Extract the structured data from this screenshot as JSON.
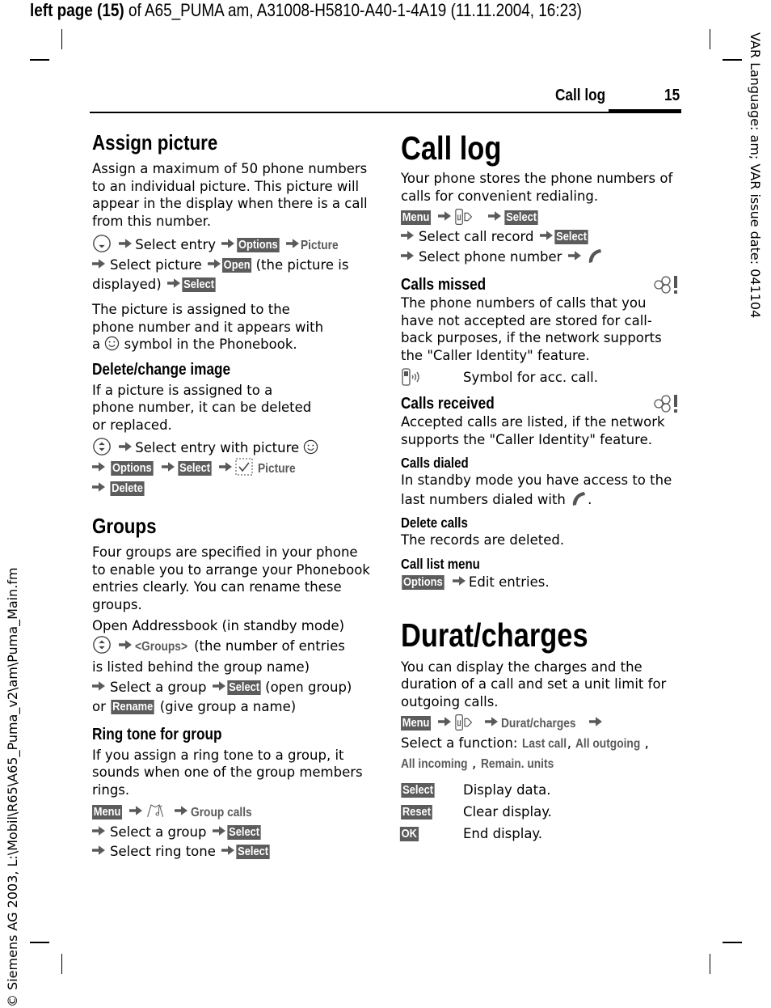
{
  "print_header": {
    "bold_part": "left page (15)",
    "rest": " of A65_PUMA am, A31008-H5810-A40-1-4A19 (11.11.2004, 16:23)"
  },
  "side_right_text": "VAR Language: am; VAR issue date: 041104",
  "side_left_text": "© Siemens AG 2003, L:\\Mobil\\R65\\A65_Puma_v2\\am\\Puma_Main.fm",
  "running_header": {
    "title": "Call log",
    "page_number": "15"
  },
  "left_column": {
    "assign_picture": {
      "heading": "Assign picture",
      "body": "Assign a maximum of 50 phone numbers to an individual picture. This picture will appear in the display when there is a call from this number.",
      "steps": {
        "s1_text": "Select entry",
        "s1_key": "Options",
        "s1_menu": "Picture",
        "s2_text": "Select picture",
        "s2_key": "Open",
        "s2_after": "(the picture is",
        "s3_text": "displayed)",
        "s3_key": "Select"
      },
      "note_line1": "The picture is assigned to the",
      "note_line2": "phone number and it appears with",
      "note_line3_a": "a",
      "note_line3_b": "symbol in the Phonebook."
    },
    "delete_change": {
      "heading": "Delete/change image",
      "body_line1": "If a picture is assigned to a",
      "body_line2": "phone number, it can be deleted",
      "body_line3": "or replaced.",
      "step1_text": "Select entry with picture",
      "step2_key1": "Options",
      "step2_key2": "Select",
      "step2_menu": "Picture",
      "step3_key": "Delete"
    },
    "groups": {
      "heading": "Groups",
      "body": "Four groups are specified in your phone to enable you to arrange your Phonebook entries clearly. You can rename these groups.",
      "open_line": "Open Addressbook (in standby mode)",
      "groups_menu": "<Groups>",
      "groups_after": "(the number of entries",
      "groups_line2": "is listed behind the group name)",
      "select_text": "Select a group",
      "select_key": "Select",
      "select_after": "(open group)",
      "or_text": "or",
      "rename_key": "Rename",
      "rename_after": "(give group a name)"
    },
    "ring_tone": {
      "heading": "Ring tone for group",
      "body": "If you assign a ring tone to a group, it sounds when one of the group members rings.",
      "menu_key": "Menu",
      "menu_item": "Group calls",
      "step2_text": "Select a group",
      "step2_key": "Select",
      "step3_text": "Select ring tone",
      "step3_key": "Select"
    }
  },
  "right_column": {
    "call_log": {
      "heading": "Call log",
      "body": "Your phone stores the phone numbers of calls for convenient redialing.",
      "menu_key": "Menu",
      "select_key": "Select",
      "step2_text": "Select call record",
      "step2_key": "Select",
      "step3_text": "Select phone number"
    },
    "calls_missed": {
      "heading": "Calls missed",
      "body": "The phone numbers of calls that you have not accepted are stored for call-back purposes, if the network supports the \"Caller Identity\" feature.",
      "symbol_desc": "Symbol for acc. call."
    },
    "calls_received": {
      "heading": "Calls received",
      "body": "Accepted calls are listed, if the network supports the \"Caller Identity\" feature."
    },
    "calls_dialed": {
      "heading": "Calls dialed",
      "body_line1": "In standby mode you have access to the",
      "body_line2": "last numbers dialed with",
      "body_end": "."
    },
    "delete_calls": {
      "heading": "Delete calls",
      "body": "The records are deleted."
    },
    "call_list_menu": {
      "heading": "Call list menu",
      "key": "Options",
      "text": "Edit entries."
    },
    "durat_charges": {
      "heading": "Durat/charges",
      "body": "You can display the charges and the duration of a call and set a unit limit for outgoing calls.",
      "menu_key": "Menu",
      "menu_item": "Durat/charges",
      "function_label": "Select a function:",
      "functions": [
        "Last call",
        "All outgoing",
        "All incoming",
        "Remain. units"
      ],
      "table": [
        {
          "key": "Select",
          "desc": "Display data."
        },
        {
          "key": "Reset",
          "desc": "Clear display."
        },
        {
          "key": "OK",
          "desc": "End display."
        }
      ]
    }
  }
}
